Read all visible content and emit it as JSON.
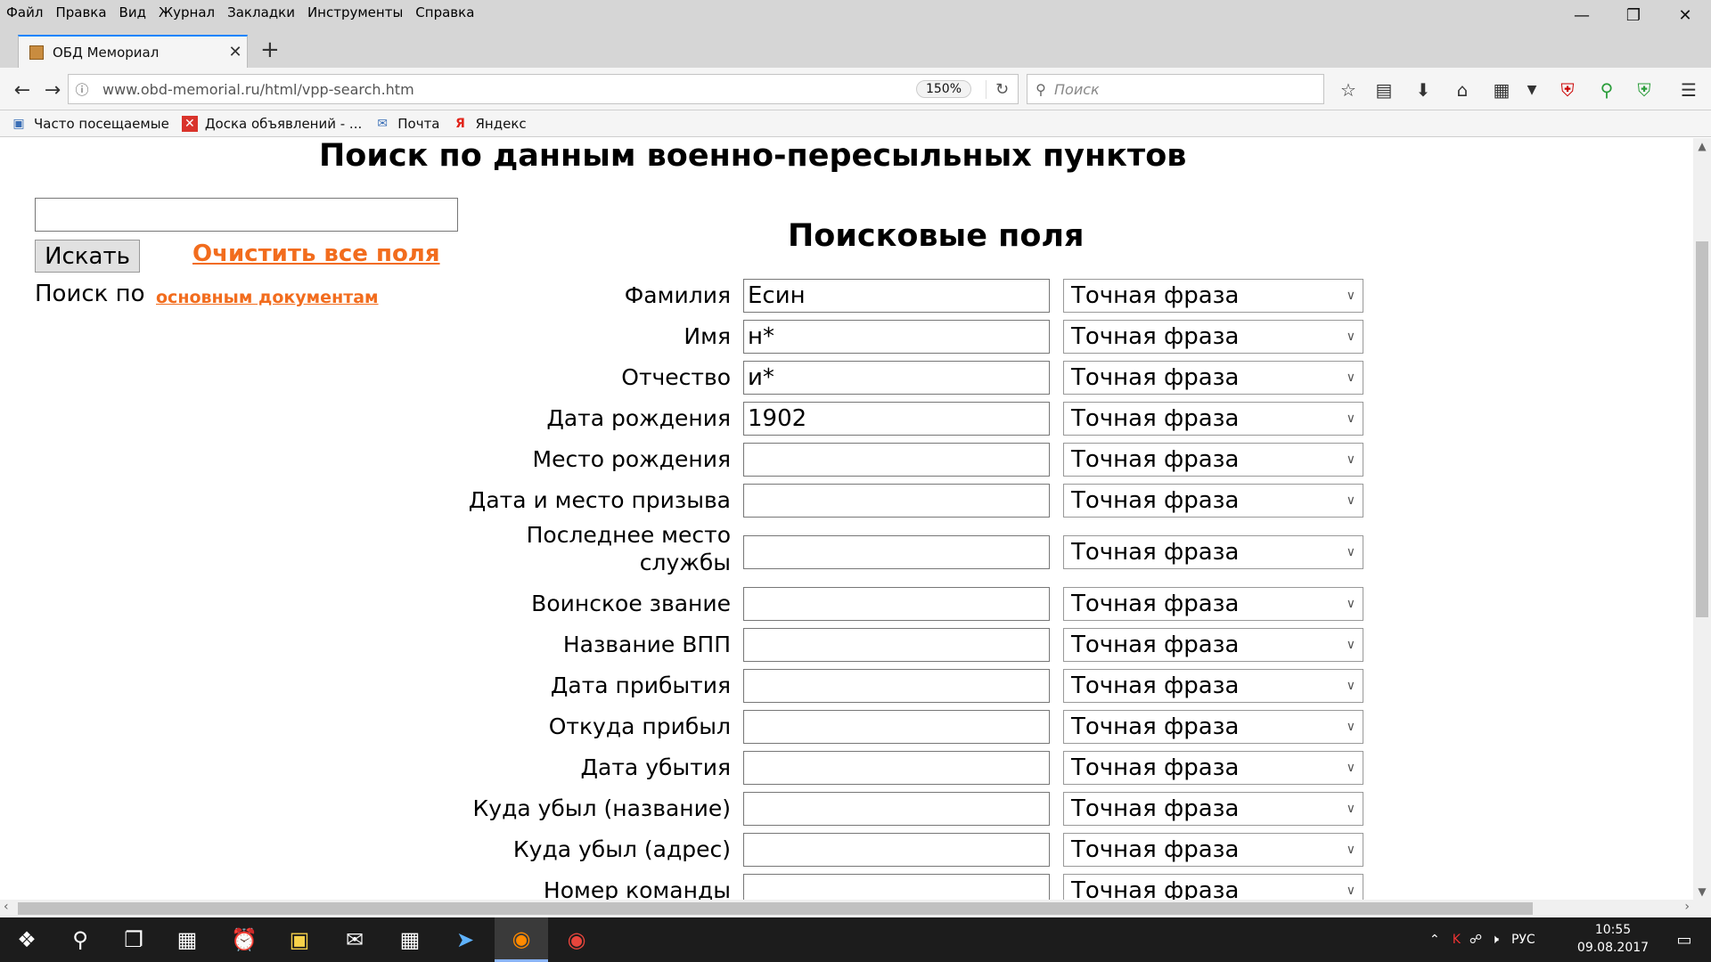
{
  "menu": [
    "Файл",
    "Правка",
    "Вид",
    "Журнал",
    "Закладки",
    "Инструменты",
    "Справка"
  ],
  "tab": {
    "title": "ОБД Мемориал"
  },
  "address": {
    "url": "www.obd-memorial.ru/html/vpp-search.htm",
    "zoom": "150%"
  },
  "search": {
    "placeholder": "Поиск"
  },
  "bookmarks": [
    "Часто посещаемые",
    "Доска объявлений - ...",
    "Почта",
    "Яндекс"
  ],
  "page": {
    "title": "Поиск по данным военно-пересыльных пунктов",
    "search_button": "Искать",
    "clear_link": "Очистить все поля",
    "search_by": "Поиск по",
    "docs_link": "основным документам",
    "fields_title": "Поисковые поля"
  },
  "fields": [
    {
      "label": "Фамилия",
      "value": "Есин",
      "mode": "Точная фраза"
    },
    {
      "label": "Имя",
      "value": "н*",
      "mode": "Точная фраза"
    },
    {
      "label": "Отчество",
      "value": "и*",
      "mode": "Точная фраза"
    },
    {
      "label": "Дата рождения",
      "value": "1902",
      "mode": "Точная фраза"
    },
    {
      "label": "Место рождения",
      "value": "",
      "mode": "Точная фраза"
    },
    {
      "label": "Дата и место призыва",
      "value": "",
      "mode": "Точная фраза"
    },
    {
      "label": "Последнее место службы",
      "value": "",
      "mode": "Точная фраза"
    },
    {
      "label": "Воинское звание",
      "value": "",
      "mode": "Точная фраза"
    },
    {
      "label": "Название ВПП",
      "value": "",
      "mode": "Точная фраза"
    },
    {
      "label": "Дата прибытия",
      "value": "",
      "mode": "Точная фраза"
    },
    {
      "label": "Откуда прибыл",
      "value": "",
      "mode": "Точная фраза"
    },
    {
      "label": "Дата убытия",
      "value": "",
      "mode": "Точная фраза"
    },
    {
      "label": "Куда убыл (название)",
      "value": "",
      "mode": "Точная фраза"
    },
    {
      "label": "Куда убыл (адрес)",
      "value": "",
      "mode": "Точная фраза"
    },
    {
      "label": "Номер команды",
      "value": "",
      "mode": "Точная фраза"
    }
  ],
  "taskbar": {
    "lang": "РУС",
    "time": "10:55",
    "date": "09.08.2017"
  },
  "icons": {
    "back": "back-arrow-icon",
    "forward": "forward-arrow-icon",
    "reload": "reload-icon",
    "star": "bookmark-star-icon",
    "download": "download-icon",
    "home": "home-icon",
    "menu": "hamburger-menu-icon"
  }
}
